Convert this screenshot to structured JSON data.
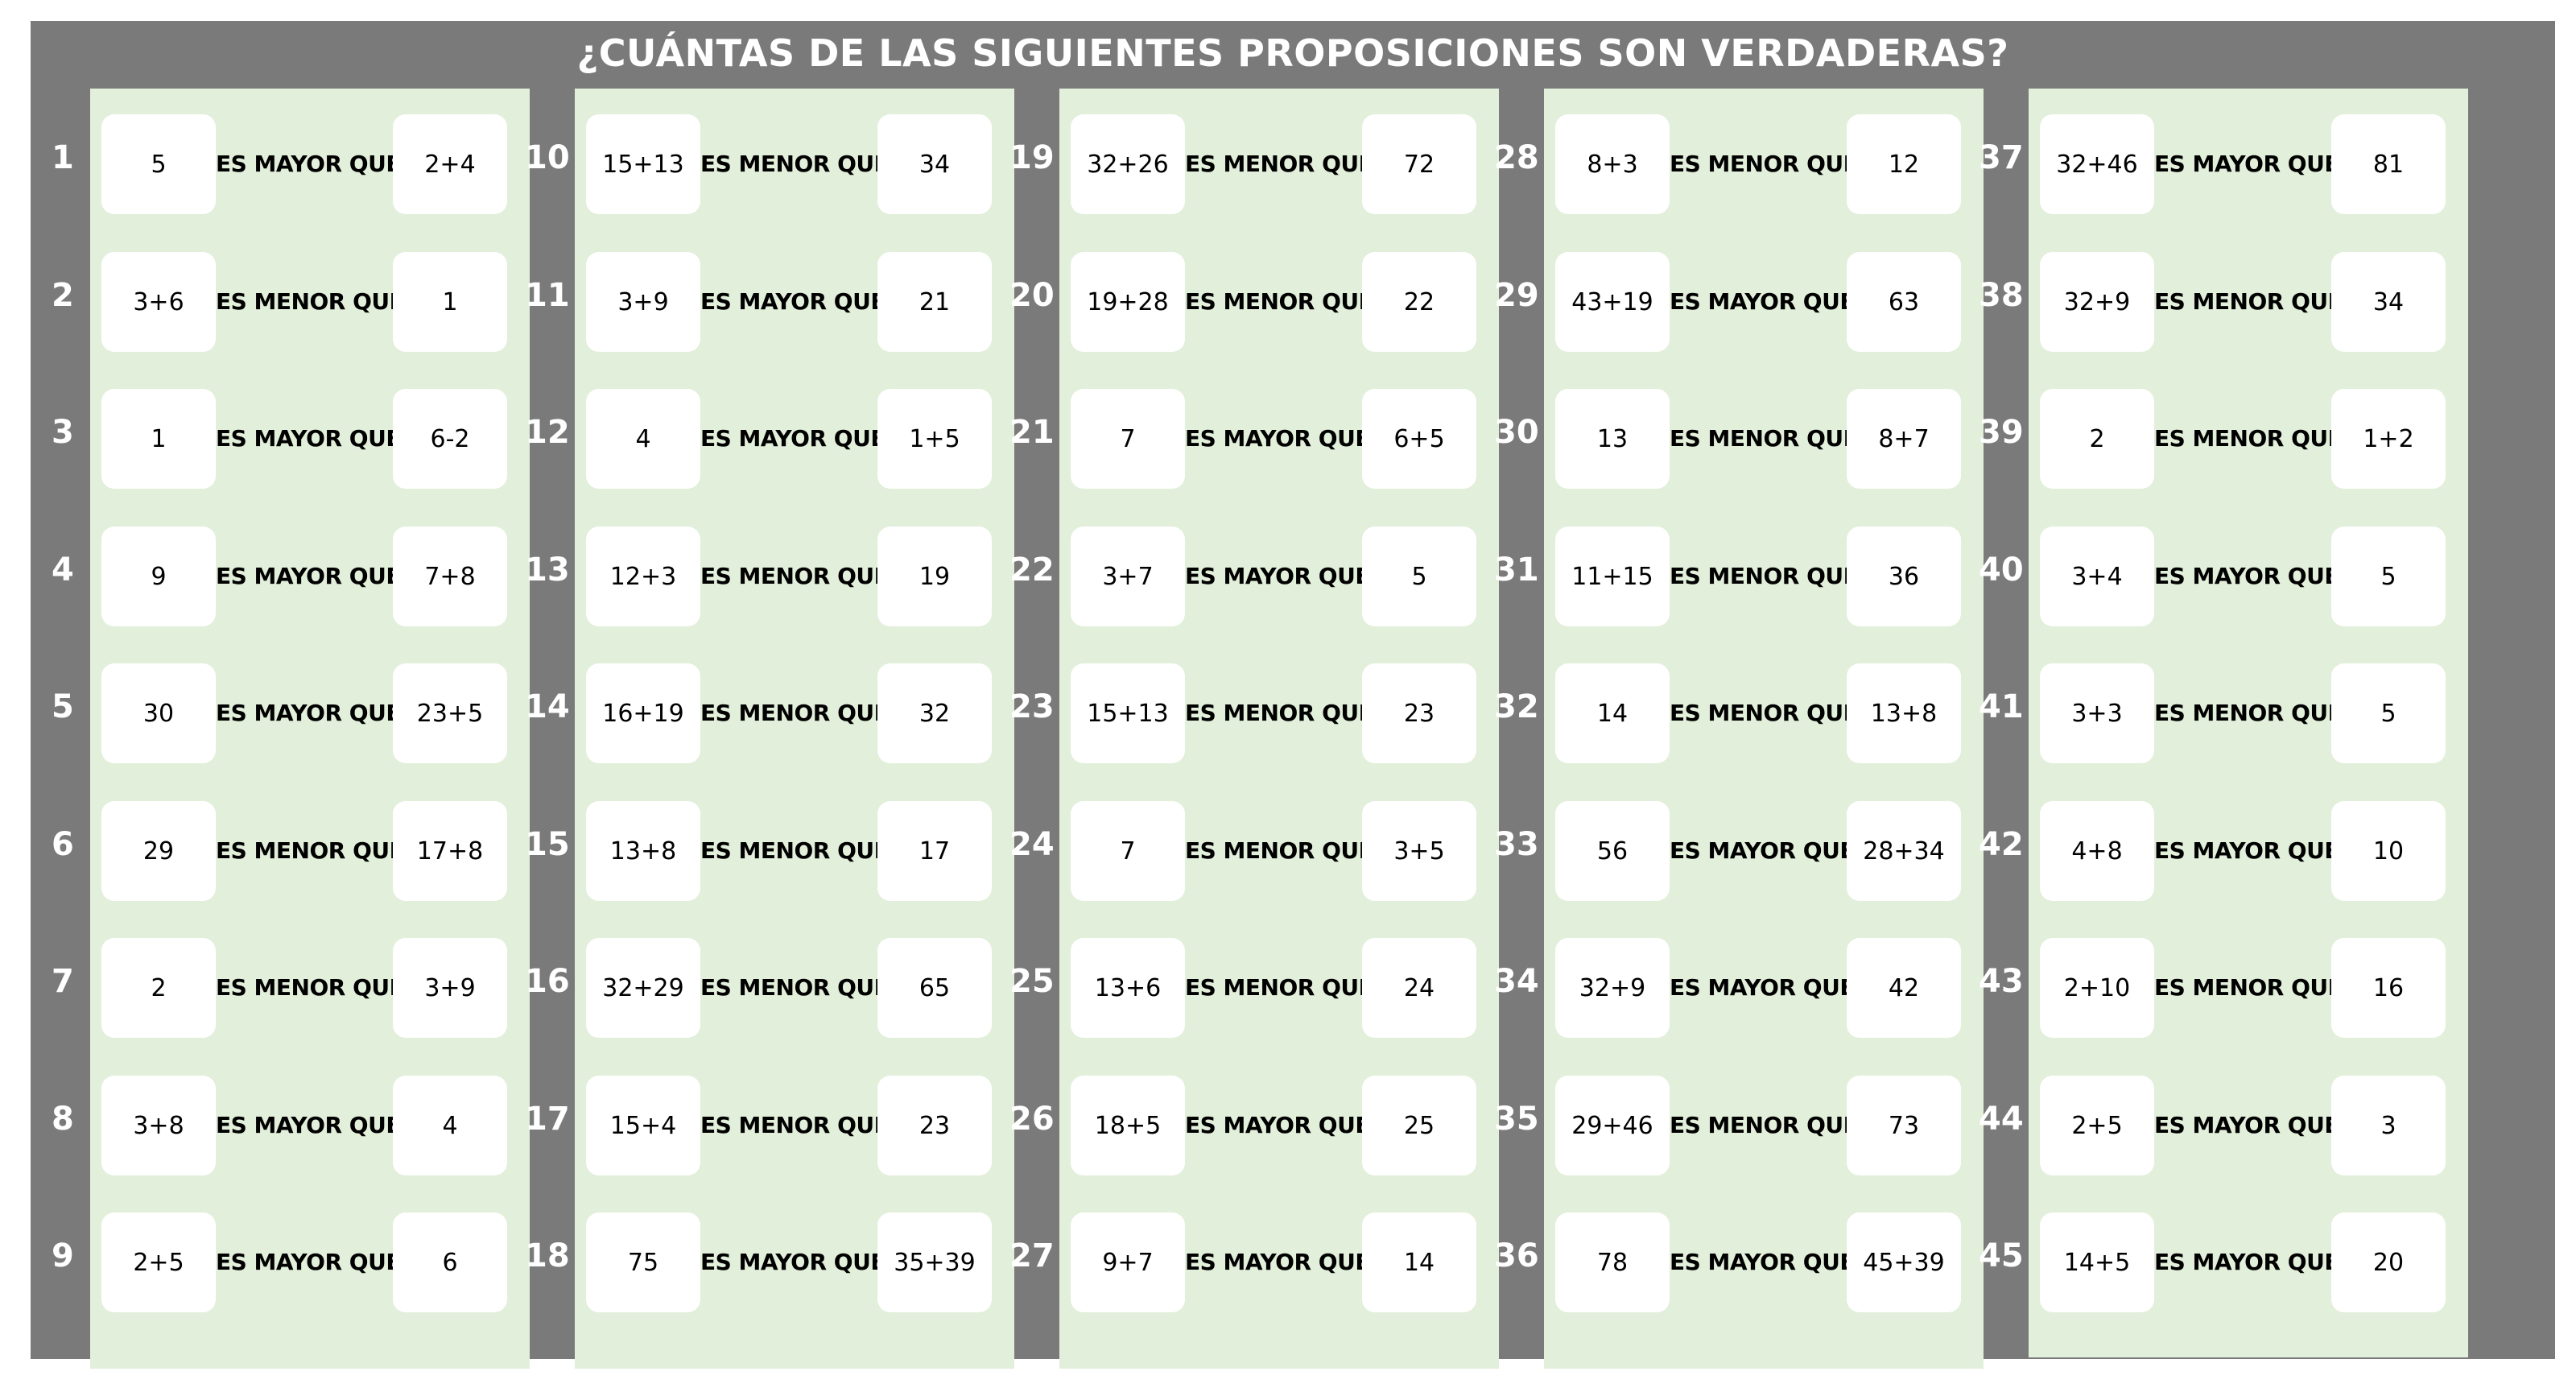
{
  "title": "¿CUÁNTAS DE LAS SIGUIENTES PROPOSICIONES SON VERDADERAS?",
  "items": [
    {
      "n": "1",
      "left": "5",
      "rel": "ES MAYOR QUE",
      "right": "2+4"
    },
    {
      "n": "2",
      "left": "3+6",
      "rel": "ES MENOR QUE",
      "right": "1"
    },
    {
      "n": "3",
      "left": "1",
      "rel": "ES MAYOR QUE",
      "right": "6-2"
    },
    {
      "n": "4",
      "left": "9",
      "rel": "ES MAYOR QUE",
      "right": "7+8"
    },
    {
      "n": "5",
      "left": "30",
      "rel": "ES MAYOR QUE",
      "right": "23+5"
    },
    {
      "n": "6",
      "left": "29",
      "rel": "ES MENOR QUE",
      "right": "17+8"
    },
    {
      "n": "7",
      "left": "2",
      "rel": "ES MENOR QUE",
      "right": "3+9"
    },
    {
      "n": "8",
      "left": "3+8",
      "rel": "ES MAYOR QUE",
      "right": "4"
    },
    {
      "n": "9",
      "left": "2+5",
      "rel": "ES MAYOR QUE",
      "right": "6"
    },
    {
      "n": "10",
      "left": "15+13",
      "rel": "ES MENOR QUE",
      "right": "34"
    },
    {
      "n": "11",
      "left": "3+9",
      "rel": "ES MAYOR QUE",
      "right": "21"
    },
    {
      "n": "12",
      "left": "4",
      "rel": "ES MAYOR QUE",
      "right": "1+5"
    },
    {
      "n": "13",
      "left": "12+3",
      "rel": "ES MENOR QUE",
      "right": "19"
    },
    {
      "n": "14",
      "left": "16+19",
      "rel": "ES MENOR QUE",
      "right": "32"
    },
    {
      "n": "15",
      "left": "13+8",
      "rel": "ES MENOR QUE",
      "right": "17"
    },
    {
      "n": "16",
      "left": "32+29",
      "rel": "ES MENOR QUE",
      "right": "65"
    },
    {
      "n": "17",
      "left": "15+4",
      "rel": "ES MENOR QUE",
      "right": "23"
    },
    {
      "n": "18",
      "left": "75",
      "rel": "ES MAYOR QUE",
      "right": "35+39"
    },
    {
      "n": "19",
      "left": "32+26",
      "rel": "ES MENOR QUE",
      "right": "72"
    },
    {
      "n": "20",
      "left": "19+28",
      "rel": "ES MENOR QUE",
      "right": "22"
    },
    {
      "n": "21",
      "left": "7",
      "rel": "ES MAYOR QUE",
      "right": "6+5"
    },
    {
      "n": "22",
      "left": "3+7",
      "rel": "ES MAYOR QUE",
      "right": "5"
    },
    {
      "n": "23",
      "left": "15+13",
      "rel": "ES MENOR QUE",
      "right": "23"
    },
    {
      "n": "24",
      "left": "7",
      "rel": "ES MENOR QUE",
      "right": "3+5"
    },
    {
      "n": "25",
      "left": "13+6",
      "rel": "ES MENOR QUE",
      "right": "24"
    },
    {
      "n": "26",
      "left": "18+5",
      "rel": "ES MAYOR QUE",
      "right": "25"
    },
    {
      "n": "27",
      "left": "9+7",
      "rel": "ES MAYOR QUE",
      "right": "14"
    },
    {
      "n": "28",
      "left": "8+3",
      "rel": "ES MENOR QUE",
      "right": "12"
    },
    {
      "n": "29",
      "left": "43+19",
      "rel": "ES MAYOR QUE",
      "right": "63"
    },
    {
      "n": "30",
      "left": "13",
      "rel": "ES MENOR QUE",
      "right": "8+7"
    },
    {
      "n": "31",
      "left": "11+15",
      "rel": "ES MENOR QUE",
      "right": "36"
    },
    {
      "n": "32",
      "left": "14",
      "rel": "ES MENOR QUE",
      "right": "13+8"
    },
    {
      "n": "33",
      "left": "56",
      "rel": "ES MAYOR QUE",
      "right": "28+34"
    },
    {
      "n": "34",
      "left": "32+9",
      "rel": "ES MAYOR QUE",
      "right": "42"
    },
    {
      "n": "35",
      "left": "29+46",
      "rel": "ES MENOR QUE",
      "right": "73"
    },
    {
      "n": "36",
      "left": "78",
      "rel": "ES MAYOR QUE",
      "right": "45+39"
    },
    {
      "n": "37",
      "left": "32+46",
      "rel": "ES MAYOR QUE",
      "right": "81"
    },
    {
      "n": "38",
      "left": "32+9",
      "rel": "ES MENOR QUE",
      "right": "34"
    },
    {
      "n": "39",
      "left": "2",
      "rel": "ES MENOR QUE",
      "right": "1+2"
    },
    {
      "n": "40",
      "left": "3+4",
      "rel": "ES MAYOR QUE",
      "right": "5"
    },
    {
      "n": "41",
      "left": "3+3",
      "rel": "ES MENOR QUE",
      "right": "5"
    },
    {
      "n": "42",
      "left": "4+8",
      "rel": "ES MAYOR QUE",
      "right": "10"
    },
    {
      "n": "43",
      "left": "2+10",
      "rel": "ES MENOR QUE",
      "right": "16"
    },
    {
      "n": "44",
      "left": "2+5",
      "rel": "ES MAYOR QUE",
      "right": "3"
    },
    {
      "n": "45",
      "left": "14+5",
      "rel": "ES MAYOR QUE",
      "right": "20"
    }
  ]
}
